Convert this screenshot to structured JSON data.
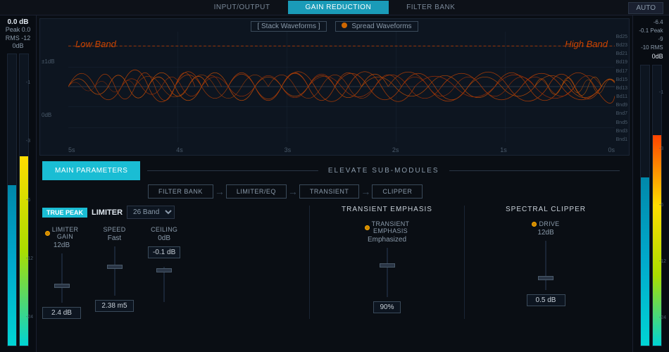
{
  "topBar": {
    "tabs": [
      {
        "id": "input-output",
        "label": "INPUT/OUTPUT",
        "active": false
      },
      {
        "id": "gain-reduction",
        "label": "GAIN REDUCTION",
        "active": true
      },
      {
        "id": "filter-bank",
        "label": "FILTER BANK",
        "active": false
      }
    ],
    "autoButton": "AUTO"
  },
  "leftMeter": {
    "dbLabel": "0.0 dB",
    "peakLabel": "Peak 0.0",
    "rmsLabel": "RMS -12",
    "dbZero": "0dB",
    "scale": [
      "",
      "-1",
      "",
      "-3",
      "",
      "-6",
      "",
      "-12",
      "",
      "-24"
    ]
  },
  "rightMeter": {
    "topLabels": [
      "-6.4",
      "-0.1 Peak",
      "-9",
      "-10 RMS",
      "0dB"
    ],
    "scale": [
      "",
      "-1",
      "",
      "-3",
      "",
      "-6",
      "",
      "-12",
      "",
      "-24"
    ]
  },
  "waveform": {
    "stackBtn": "Stack Waveforms",
    "spreadBtn": "Spread Waveforms",
    "bandLabelLeft": "Low Band",
    "bandLabelRight": "High Band",
    "timeScale": [
      "5s",
      "4s",
      "3s",
      "2s",
      "1s",
      "0s"
    ],
    "dbScaleLeft": [
      "±1dB",
      "",
      "0dB"
    ],
    "bndLabels": [
      "Bd25",
      "Bd23",
      "Bd21",
      "Bd19",
      "Bd17",
      "Bd15",
      "Bd13",
      "Bd11",
      "Bnd9",
      "Bnd7",
      "Bnd5",
      "Bnd3",
      "Bnd1"
    ]
  },
  "submodules": {
    "elevateLabel": "ELEVATE SUB-MODULES",
    "mainParamsBtn": "MAIN PARAMETERS",
    "modules": [
      {
        "label": "FILTER BANK"
      },
      {
        "label": "LIMITER/EQ"
      },
      {
        "label": "TRANSIENT"
      },
      {
        "label": "CLIPPER"
      }
    ]
  },
  "limiter": {
    "truePeakLabel": "TRUE PEAK",
    "limiterLabel": "LIMITER",
    "bandSelect": "26 Band",
    "params": [
      {
        "id": "limiter-gain",
        "dotColor": "orange",
        "label": "LIMITER\nGAIN",
        "value": "12dB",
        "sliderVal": "2.4 dB"
      },
      {
        "id": "speed",
        "label": "SPEED",
        "value": "Fast",
        "sliderVal": "2.38 m5"
      },
      {
        "id": "ceiling",
        "label": "CEILING",
        "value": "0dB",
        "sliderVal": "-0.1 dB"
      }
    ]
  },
  "transientEmphasis": {
    "title": "TRANSIENT EMPHASIS",
    "dotColor": "orange",
    "label": "TRANSIENT\nEMPHASIS",
    "value": "Emphasized",
    "percentBadge": "90%"
  },
  "spectralClipper": {
    "title": "SPECTRAL CLIPPER",
    "dotColor": "orange",
    "label": "DRIVE",
    "value": "12dB",
    "sliderVal": "0.5 dB"
  }
}
